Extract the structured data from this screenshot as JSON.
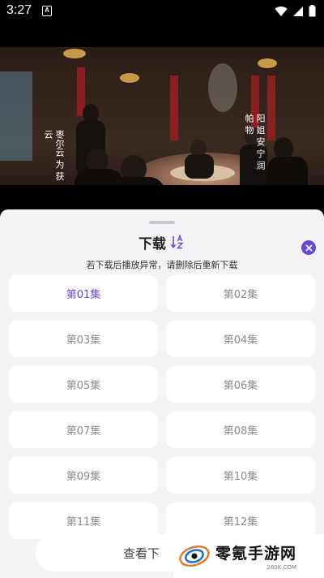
{
  "status_bar": {
    "time": "3:27",
    "notification_glyph": "A",
    "icons": [
      "wifi-icon",
      "signal-icon",
      "battery-icon"
    ]
  },
  "video": {
    "subtitle_left": [
      "枣尔云",
      "为 获云"
    ],
    "subtitle_right": [
      "阳 姐 安 宁",
      "润 帕 物"
    ]
  },
  "download_sheet": {
    "title": "下载",
    "sort_icon": "sort-az-icon",
    "close_icon": "close-icon",
    "notice": "若下载后播放异常，请删除后重新下载",
    "accent_color": "#6a48d8",
    "episodes": [
      {
        "label": "第01集",
        "selected": true
      },
      {
        "label": "第02集",
        "selected": false
      },
      {
        "label": "第03集",
        "selected": false
      },
      {
        "label": "第04集",
        "selected": false
      },
      {
        "label": "第05集",
        "selected": false
      },
      {
        "label": "第06集",
        "selected": false
      },
      {
        "label": "第07集",
        "selected": false
      },
      {
        "label": "第08集",
        "selected": false
      },
      {
        "label": "第09集",
        "selected": false
      },
      {
        "label": "第10集",
        "selected": false
      },
      {
        "label": "第11集",
        "selected": false
      },
      {
        "label": "第12集",
        "selected": false
      }
    ],
    "view_downloads_label": "查看下"
  },
  "watermark": {
    "title": "零氪手游网",
    "url": "260K.COM"
  }
}
